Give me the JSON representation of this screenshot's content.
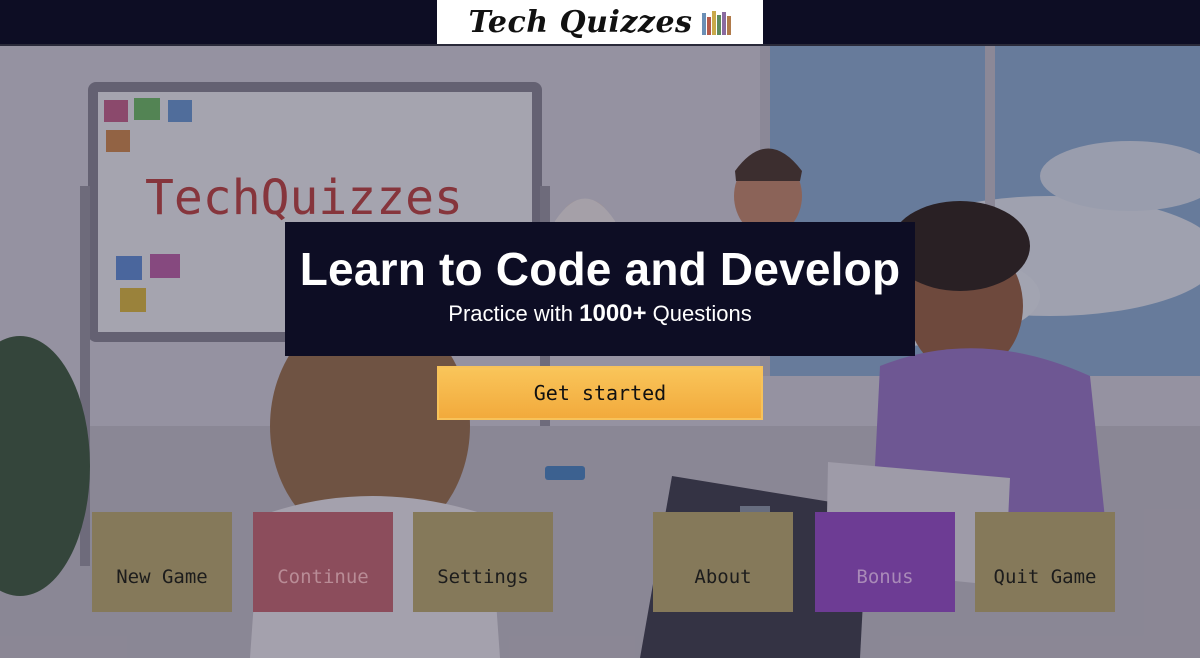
{
  "header": {
    "logo_text": "Tech Quizzes"
  },
  "scene": {
    "whiteboard_text": "TechQuizzes"
  },
  "hero": {
    "title": "Learn to Code and Develop",
    "subtitle_prefix": "Practice with",
    "subtitle_count": "1000+",
    "subtitle_suffix": "Questions"
  },
  "cta": {
    "label": "Get started"
  },
  "menu": {
    "new_game": "New Game",
    "continue": "Continue",
    "settings": "Settings",
    "about": "About",
    "bonus": "Bonus",
    "quit_game": "Quit Game"
  },
  "colors": {
    "header_bg": "#0d0d24",
    "cta_bg": "#f6b84a",
    "button_khaki": "#85795a",
    "button_red": "#8c4d5c",
    "button_purple": "#6d3c94"
  }
}
